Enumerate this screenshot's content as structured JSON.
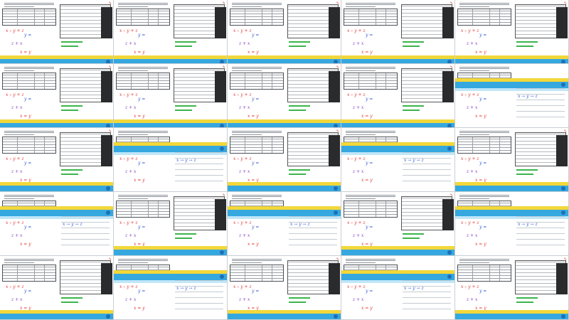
{
  "colors": {
    "background": "#d9dde2",
    "band_yellow": "#f2d73a",
    "band_blue": "#35a8df",
    "ink_red": "#e0342f",
    "ink_blue": "#2f57d6",
    "ink_purple": "#8a3fbf",
    "ink_green": "#2f9a3a"
  },
  "tile_template": {
    "page_label": "Bilanc",
    "handwriting": [
      "x",
      "+",
      "y",
      "=",
      "z"
    ]
  },
  "tiles": [
    {
      "kind": "table-worksheet"
    },
    {
      "kind": "table-worksheet"
    },
    {
      "kind": "table-worksheet"
    },
    {
      "kind": "table-worksheet"
    },
    {
      "kind": "table-worksheet"
    },
    {
      "kind": "table-worksheet"
    },
    {
      "kind": "table-worksheet"
    },
    {
      "kind": "table-worksheet"
    },
    {
      "kind": "table-worksheet"
    },
    {
      "kind": "note-band"
    },
    {
      "kind": "table-band"
    },
    {
      "kind": "note-band"
    },
    {
      "kind": "table-band"
    },
    {
      "kind": "note-band"
    },
    {
      "kind": "table-band"
    },
    {
      "kind": "note-band"
    },
    {
      "kind": "table-band"
    },
    {
      "kind": "note-band"
    },
    {
      "kind": "table-band"
    },
    {
      "kind": "note-band"
    },
    {
      "kind": "table-band"
    },
    {
      "kind": "note-band"
    },
    {
      "kind": "table-band"
    },
    {
      "kind": "note-band"
    },
    {
      "kind": "table-band"
    }
  ]
}
